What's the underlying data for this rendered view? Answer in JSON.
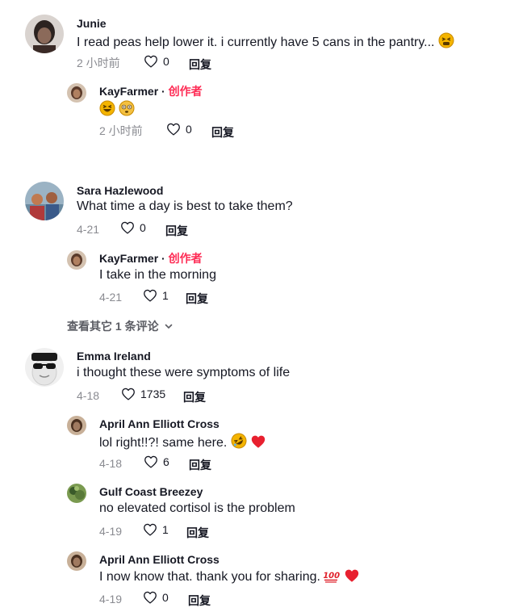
{
  "comments": [
    {
      "username": "Junie",
      "text": "I read peas help lower it. i currently have 5 cans in the pantry...",
      "time": "2 小时前",
      "likes": "0",
      "reply_label": "回复",
      "avatar_colors": [
        "#8b6a5a",
        "#2c2320"
      ],
      "replies": [
        {
          "username": "KayFarmer",
          "sep": "·",
          "creator_badge": "创作者",
          "text": "",
          "time": "2 小时前",
          "likes": "0",
          "reply_label": "回复",
          "avatar_colors": [
            "#b08060",
            "#5a3a2a"
          ]
        }
      ]
    },
    {
      "username": "Sara Hazlewood",
      "text": "What time a day is best to take them?",
      "time": "4-21",
      "likes": "0",
      "reply_label": "回复",
      "avatar_colors": [
        "#6a8aa0",
        "#c07a50"
      ],
      "replies": [
        {
          "username": "KayFarmer",
          "sep": "·",
          "creator_badge": "创作者",
          "text": "I take in the morning",
          "time": "4-21",
          "likes": "1",
          "reply_label": "回复",
          "avatar_colors": [
            "#b08060",
            "#5a3a2a"
          ]
        }
      ],
      "view_more": "查看其它 1 条评论"
    },
    {
      "username": "Emma Ireland",
      "text": "i thought these were symptoms of life",
      "time": "4-18",
      "likes": "1735",
      "reply_label": "回复",
      "avatar_colors": [
        "#e8e8e8",
        "#222222"
      ],
      "replies": [
        {
          "username": "April Ann Elliott Cross",
          "text": "lol right!!?! same here.",
          "time": "4-18",
          "likes": "6",
          "reply_label": "回复",
          "avatar_colors": [
            "#a07a60",
            "#4a3020"
          ]
        },
        {
          "username": "Gulf Coast Breezey",
          "text": "no elevated cortisol is the problem",
          "time": "4-19",
          "likes": "1",
          "reply_label": "回复",
          "avatar_colors": [
            "#7a9a50",
            "#3a5a2a"
          ]
        },
        {
          "username": "April Ann Elliott Cross",
          "text": "I now know that. thank you for sharing.",
          "time": "4-19",
          "likes": "0",
          "reply_label": "回复",
          "avatar_colors": [
            "#a07a60",
            "#4a3020"
          ]
        }
      ]
    }
  ],
  "icons": {
    "heart_outline": "heart-outline-icon",
    "chevron": "chevron-down-icon",
    "emoji_tired": "tired-face-emoji",
    "emoji_grin": "grinning-squint-emoji",
    "emoji_flushed": "flushed-face-emoji",
    "emoji_rofl": "rolling-laughing-emoji",
    "emoji_heart": "red-heart-emoji",
    "emoji_hundred": "hundred-points-emoji"
  },
  "colors": {
    "creator_badge": "#fe2c55",
    "meta_gray": "#8a8b91",
    "heart_red": "#e8202f"
  }
}
